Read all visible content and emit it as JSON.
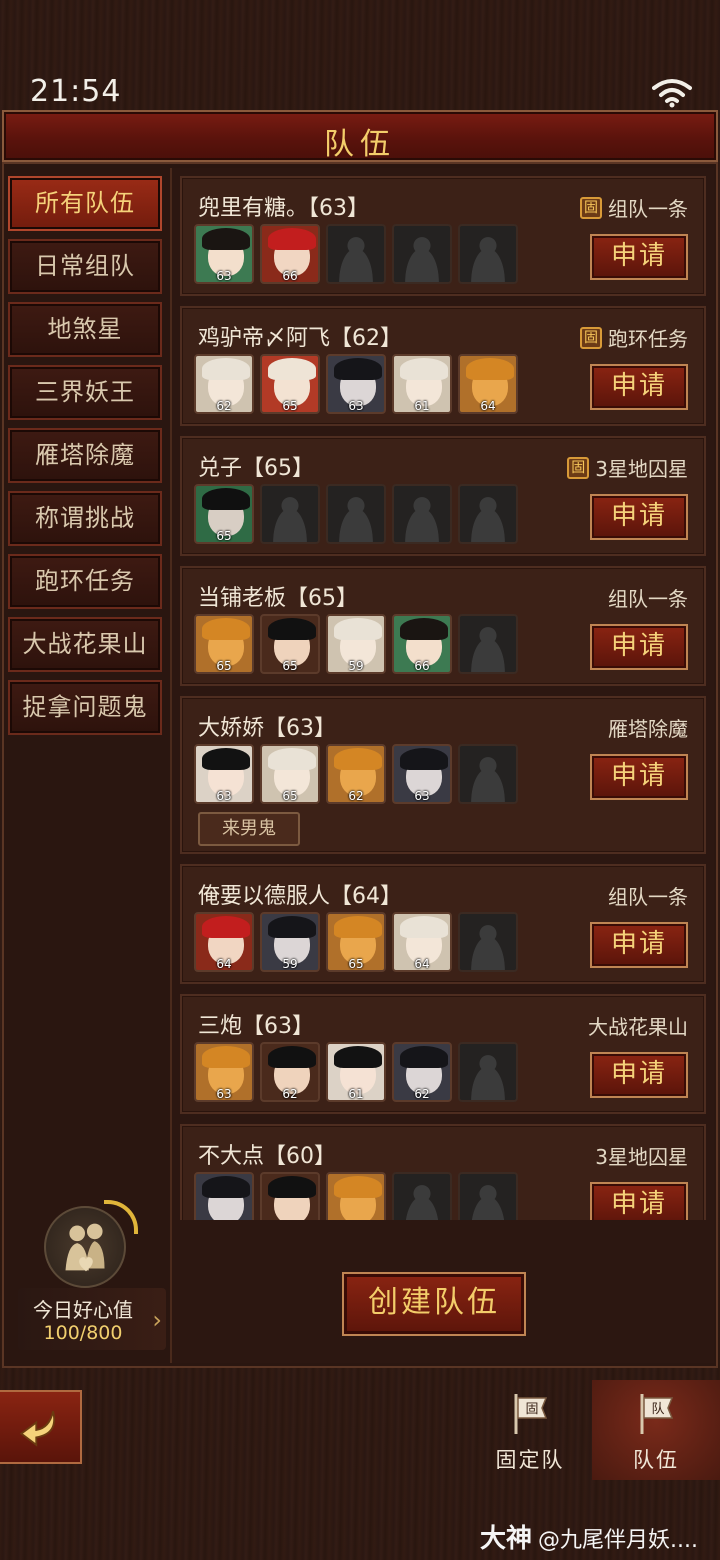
{
  "status": {
    "time": "21:54"
  },
  "header": {
    "title": "队伍"
  },
  "sidebar": {
    "items": [
      {
        "label": "所有队伍",
        "active": true
      },
      {
        "label": "日常组队"
      },
      {
        "label": "地煞星"
      },
      {
        "label": "三界妖王"
      },
      {
        "label": "雁塔除魔"
      },
      {
        "label": "称谓挑战"
      },
      {
        "label": "跑环任务"
      },
      {
        "label": "大战花果山"
      },
      {
        "label": "捉拿问题鬼"
      }
    ]
  },
  "teams": [
    {
      "name": "兜里有糖。【63】",
      "task": "组队一条",
      "fixed": true,
      "fixed_icon": "固",
      "apply": "申请",
      "members": [
        {
          "level": "63",
          "look": "green"
        },
        {
          "level": "66",
          "look": "red"
        },
        null,
        null,
        null
      ]
    },
    {
      "name": "鸡驴帝〆阿飞【62】",
      "task": "跑环任务",
      "fixed": true,
      "fixed_icon": "固",
      "apply": "申请",
      "members": [
        {
          "level": "62",
          "look": "pale"
        },
        {
          "level": "65",
          "look": "redpale"
        },
        {
          "level": "63",
          "look": "dark"
        },
        {
          "level": "61",
          "look": "pale"
        },
        {
          "level": "64",
          "look": "tiger"
        }
      ]
    },
    {
      "name": "兑子【65】",
      "task": "3星地囚星",
      "fixed": true,
      "fixed_icon": "固",
      "apply": "申请",
      "members": [
        {
          "level": "65",
          "look": "greendark"
        },
        null,
        null,
        null,
        null
      ]
    },
    {
      "name": "当铺老板【65】",
      "task": "组队一条",
      "fixed": false,
      "apply": "申请",
      "members": [
        {
          "level": "65",
          "look": "tiger"
        },
        {
          "level": "65",
          "look": "man"
        },
        {
          "level": "59",
          "look": "pale"
        },
        {
          "level": "66",
          "look": "green"
        },
        null
      ]
    },
    {
      "name": "大娇娇【63】",
      "task": "雁塔除魔",
      "fixed": false,
      "apply": "申请",
      "tag": "来男鬼",
      "members": [
        {
          "level": "63",
          "look": "girl"
        },
        {
          "level": "65",
          "look": "pale"
        },
        {
          "level": "62",
          "look": "tiger"
        },
        {
          "level": "63",
          "look": "dark"
        },
        null
      ]
    },
    {
      "name": "俺要以德服人【64】",
      "task": "组队一条",
      "fixed": false,
      "apply": "申请",
      "members": [
        {
          "level": "64",
          "look": "red"
        },
        {
          "level": "59",
          "look": "dark"
        },
        {
          "level": "65",
          "look": "tiger"
        },
        {
          "level": "64",
          "look": "pale"
        },
        null
      ]
    },
    {
      "name": "三炮【63】",
      "task": "大战花果山",
      "fixed": false,
      "apply": "申请",
      "members": [
        {
          "level": "63",
          "look": "tiger"
        },
        {
          "level": "62",
          "look": "man"
        },
        {
          "level": "61",
          "look": "girl"
        },
        {
          "level": "62",
          "look": "dark"
        },
        null
      ]
    },
    {
      "name": "不大点【60】",
      "task": "3星地囚星",
      "fixed": false,
      "apply": "申请",
      "members": [
        {
          "level": "",
          "look": "dark"
        },
        {
          "level": "",
          "look": "man"
        },
        {
          "level": "",
          "look": "tiger"
        },
        null,
        null
      ]
    }
  ],
  "friendship": {
    "label": "今日好心值",
    "value": "100/800"
  },
  "actions": {
    "create": "创建队伍"
  },
  "bottom_nav": {
    "fixed_team": "固定队",
    "fixed_icon": "固",
    "team": "队伍",
    "team_icon": "队",
    "back_icon": "back-arrow"
  },
  "watermark": {
    "brand": "大神",
    "user": "@九尾伴月妖...."
  }
}
